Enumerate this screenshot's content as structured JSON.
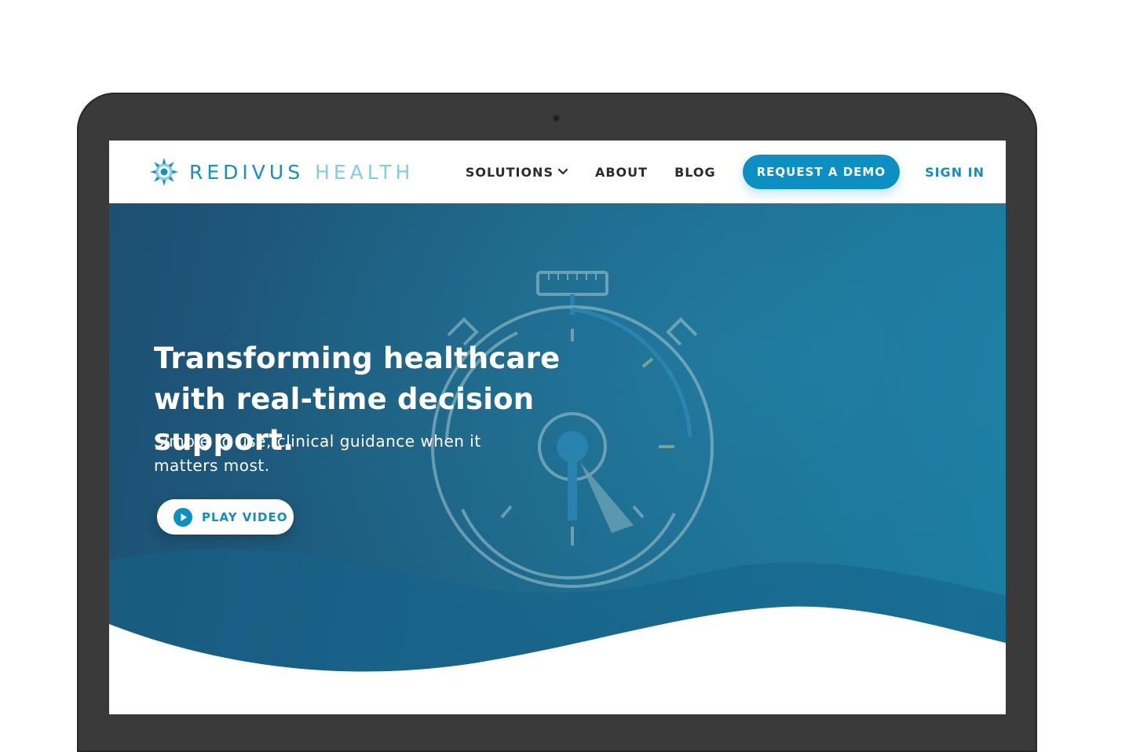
{
  "brand": {
    "name_part1": "REDIVUS",
    "name_part2": "HEALTH",
    "primary_color": "#0e8fc4",
    "light_color": "#7fcde6"
  },
  "nav": {
    "items": [
      {
        "label": "SOLUTIONS",
        "has_dropdown": true
      },
      {
        "label": "ABOUT",
        "has_dropdown": false
      },
      {
        "label": "BLOG",
        "has_dropdown": false
      }
    ],
    "cta_label": "REQUEST A DEMO",
    "signin_label": "SIGN IN"
  },
  "hero": {
    "title": "Transforming healthcare with real-time decision support.",
    "subtitle": "Simple to use, clinical guidance when it matters most.",
    "play_label": "PLAY VIDEO",
    "background_icon": "stopwatch-illustration"
  }
}
